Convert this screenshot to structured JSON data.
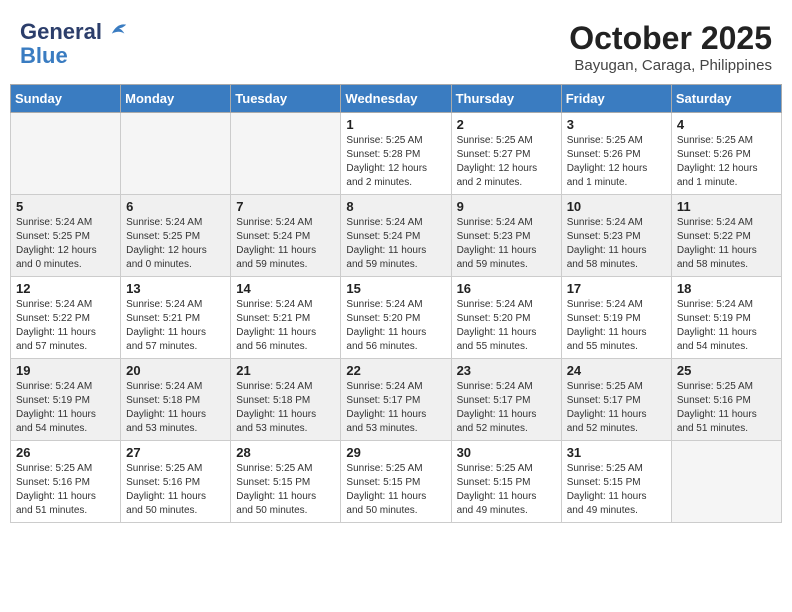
{
  "header": {
    "logo_line1": "General",
    "logo_line2": "Blue",
    "month": "October 2025",
    "location": "Bayugan, Caraga, Philippines"
  },
  "weekdays": [
    "Sunday",
    "Monday",
    "Tuesday",
    "Wednesday",
    "Thursday",
    "Friday",
    "Saturday"
  ],
  "weeks": [
    [
      {
        "day": "",
        "info": ""
      },
      {
        "day": "",
        "info": ""
      },
      {
        "day": "",
        "info": ""
      },
      {
        "day": "1",
        "info": "Sunrise: 5:25 AM\nSunset: 5:28 PM\nDaylight: 12 hours\nand 2 minutes."
      },
      {
        "day": "2",
        "info": "Sunrise: 5:25 AM\nSunset: 5:27 PM\nDaylight: 12 hours\nand 2 minutes."
      },
      {
        "day": "3",
        "info": "Sunrise: 5:25 AM\nSunset: 5:26 PM\nDaylight: 12 hours\nand 1 minute."
      },
      {
        "day": "4",
        "info": "Sunrise: 5:25 AM\nSunset: 5:26 PM\nDaylight: 12 hours\nand 1 minute."
      }
    ],
    [
      {
        "day": "5",
        "info": "Sunrise: 5:24 AM\nSunset: 5:25 PM\nDaylight: 12 hours\nand 0 minutes."
      },
      {
        "day": "6",
        "info": "Sunrise: 5:24 AM\nSunset: 5:25 PM\nDaylight: 12 hours\nand 0 minutes."
      },
      {
        "day": "7",
        "info": "Sunrise: 5:24 AM\nSunset: 5:24 PM\nDaylight: 11 hours\nand 59 minutes."
      },
      {
        "day": "8",
        "info": "Sunrise: 5:24 AM\nSunset: 5:24 PM\nDaylight: 11 hours\nand 59 minutes."
      },
      {
        "day": "9",
        "info": "Sunrise: 5:24 AM\nSunset: 5:23 PM\nDaylight: 11 hours\nand 59 minutes."
      },
      {
        "day": "10",
        "info": "Sunrise: 5:24 AM\nSunset: 5:23 PM\nDaylight: 11 hours\nand 58 minutes."
      },
      {
        "day": "11",
        "info": "Sunrise: 5:24 AM\nSunset: 5:22 PM\nDaylight: 11 hours\nand 58 minutes."
      }
    ],
    [
      {
        "day": "12",
        "info": "Sunrise: 5:24 AM\nSunset: 5:22 PM\nDaylight: 11 hours\nand 57 minutes."
      },
      {
        "day": "13",
        "info": "Sunrise: 5:24 AM\nSunset: 5:21 PM\nDaylight: 11 hours\nand 57 minutes."
      },
      {
        "day": "14",
        "info": "Sunrise: 5:24 AM\nSunset: 5:21 PM\nDaylight: 11 hours\nand 56 minutes."
      },
      {
        "day": "15",
        "info": "Sunrise: 5:24 AM\nSunset: 5:20 PM\nDaylight: 11 hours\nand 56 minutes."
      },
      {
        "day": "16",
        "info": "Sunrise: 5:24 AM\nSunset: 5:20 PM\nDaylight: 11 hours\nand 55 minutes."
      },
      {
        "day": "17",
        "info": "Sunrise: 5:24 AM\nSunset: 5:19 PM\nDaylight: 11 hours\nand 55 minutes."
      },
      {
        "day": "18",
        "info": "Sunrise: 5:24 AM\nSunset: 5:19 PM\nDaylight: 11 hours\nand 54 minutes."
      }
    ],
    [
      {
        "day": "19",
        "info": "Sunrise: 5:24 AM\nSunset: 5:19 PM\nDaylight: 11 hours\nand 54 minutes."
      },
      {
        "day": "20",
        "info": "Sunrise: 5:24 AM\nSunset: 5:18 PM\nDaylight: 11 hours\nand 53 minutes."
      },
      {
        "day": "21",
        "info": "Sunrise: 5:24 AM\nSunset: 5:18 PM\nDaylight: 11 hours\nand 53 minutes."
      },
      {
        "day": "22",
        "info": "Sunrise: 5:24 AM\nSunset: 5:17 PM\nDaylight: 11 hours\nand 53 minutes."
      },
      {
        "day": "23",
        "info": "Sunrise: 5:24 AM\nSunset: 5:17 PM\nDaylight: 11 hours\nand 52 minutes."
      },
      {
        "day": "24",
        "info": "Sunrise: 5:25 AM\nSunset: 5:17 PM\nDaylight: 11 hours\nand 52 minutes."
      },
      {
        "day": "25",
        "info": "Sunrise: 5:25 AM\nSunset: 5:16 PM\nDaylight: 11 hours\nand 51 minutes."
      }
    ],
    [
      {
        "day": "26",
        "info": "Sunrise: 5:25 AM\nSunset: 5:16 PM\nDaylight: 11 hours\nand 51 minutes."
      },
      {
        "day": "27",
        "info": "Sunrise: 5:25 AM\nSunset: 5:16 PM\nDaylight: 11 hours\nand 50 minutes."
      },
      {
        "day": "28",
        "info": "Sunrise: 5:25 AM\nSunset: 5:15 PM\nDaylight: 11 hours\nand 50 minutes."
      },
      {
        "day": "29",
        "info": "Sunrise: 5:25 AM\nSunset: 5:15 PM\nDaylight: 11 hours\nand 50 minutes."
      },
      {
        "day": "30",
        "info": "Sunrise: 5:25 AM\nSunset: 5:15 PM\nDaylight: 11 hours\nand 49 minutes."
      },
      {
        "day": "31",
        "info": "Sunrise: 5:25 AM\nSunset: 5:15 PM\nDaylight: 11 hours\nand 49 minutes."
      },
      {
        "day": "",
        "info": ""
      }
    ]
  ]
}
